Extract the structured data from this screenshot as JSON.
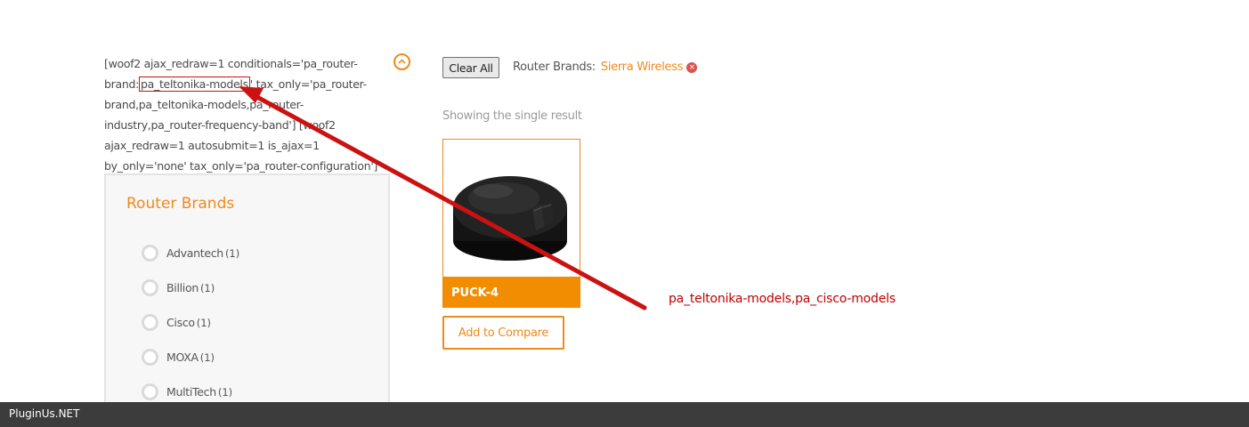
{
  "shortcode": {
    "part1": "[woof2 ajax_redraw=1 conditionals='pa_router-brand:",
    "highlighted": "pa_teltonika-models",
    "part2": "' tax_only='pa_router-brand,pa_teltonika-models,pa_router-industry,pa_router-frequency-band'] [woof2 ajax_redraw=1 autosubmit=1 is_ajax=1 by_only='none' tax_only='pa_router-configuration']"
  },
  "filter_panel": {
    "title": "Router Brands",
    "brands": [
      {
        "label": "Advantech",
        "count": "(1)"
      },
      {
        "label": "Billion",
        "count": "(1)"
      },
      {
        "label": "Cisco",
        "count": "(1)"
      },
      {
        "label": "MOXA",
        "count": "(1)"
      },
      {
        "label": "MultiTech",
        "count": "(1)"
      }
    ]
  },
  "toolbar": {
    "clear_all_label": "Clear All",
    "active_filter_label": "Router Brands:",
    "active_filter_value": "Sierra Wireless",
    "remove_icon": "×"
  },
  "results": {
    "count_text": "Showing the single result",
    "product": {
      "name": "PUCK-4",
      "compare_label": "Add to Compare"
    }
  },
  "annotation": {
    "text": "pa_teltonika-models,pa_cisco-models",
    "color": "#c00000"
  },
  "footer": {
    "brand": "PluginUs.NET"
  },
  "colors": {
    "accent": "#f08a1c",
    "product_bar": "#f28c00",
    "footer_bg": "#3c3c3c"
  }
}
